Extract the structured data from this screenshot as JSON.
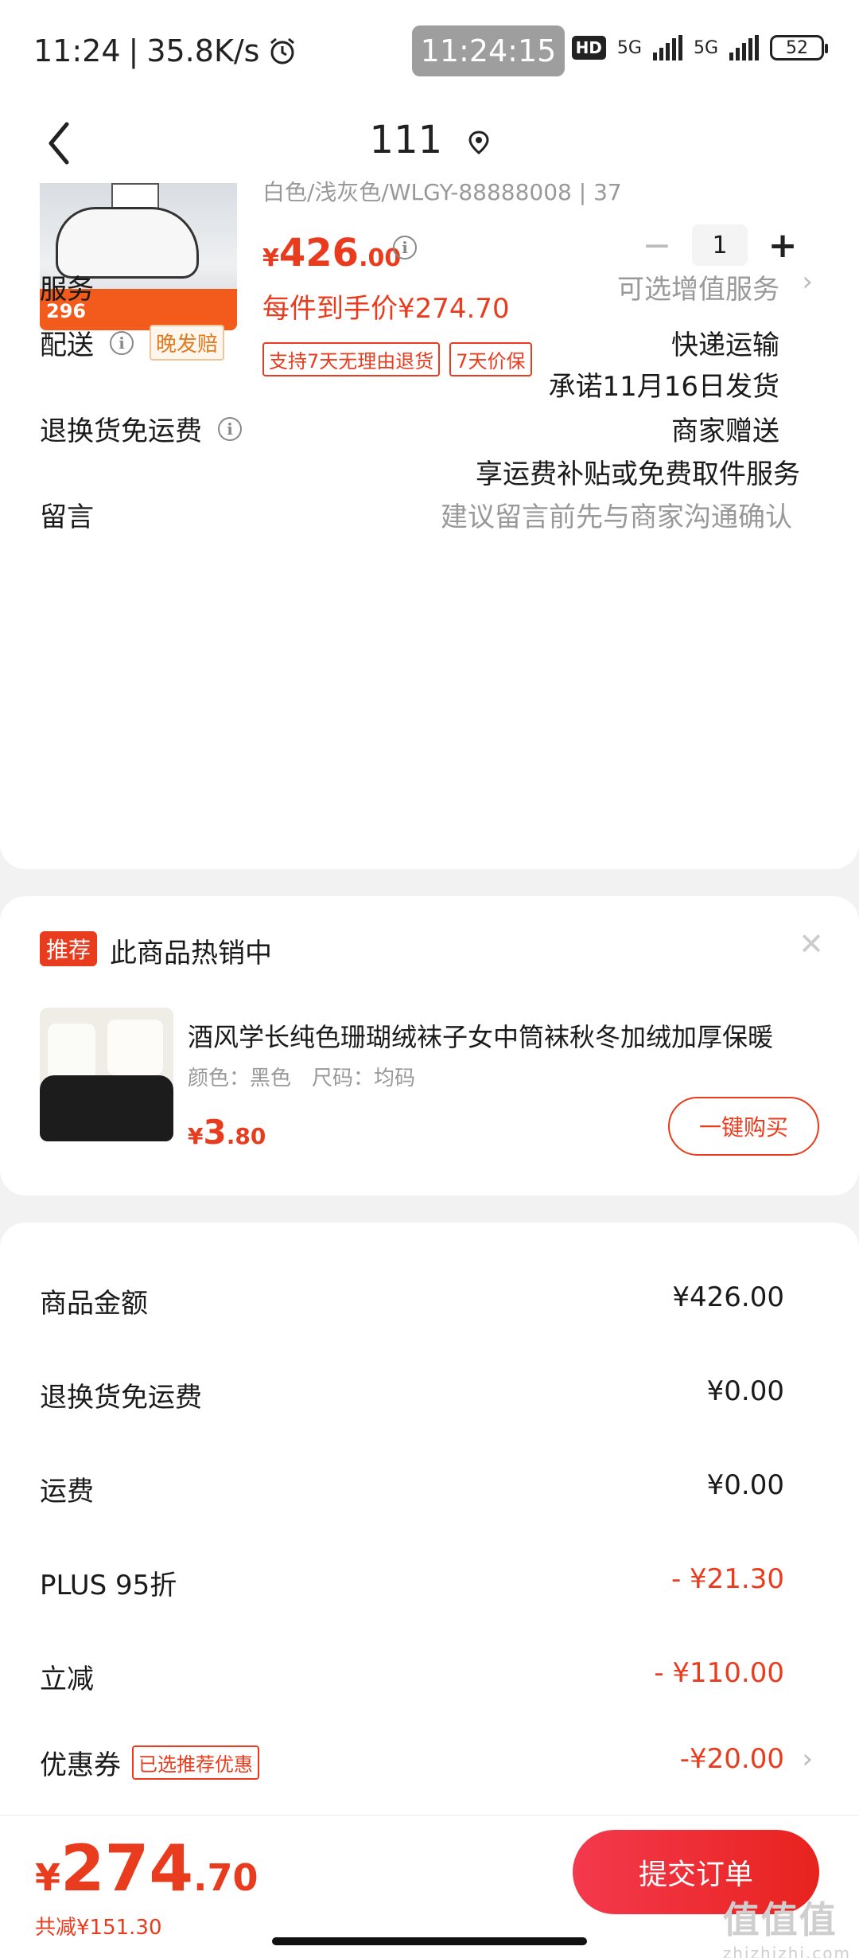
{
  "status_bar": {
    "time": "11:24",
    "net_speed": "35.8K/s",
    "center_time": "11:24:15",
    "network_hd": "HD",
    "signal_1": "5G",
    "signal_2": "5G",
    "battery": "52"
  },
  "header": {
    "title": "111"
  },
  "product": {
    "sku_text": "白色/浅灰色/WLGY-88888008 | 37",
    "image_band_text": "296",
    "price_symbol": "¥",
    "price_int": "426",
    "price_dec": ".00",
    "unit_price": "每件到手价¥274.70",
    "quantity": "1",
    "tags": [
      "支持7天无理由退货",
      "7天价保"
    ]
  },
  "rows": {
    "service_label": "服务",
    "service_value": "可选增值服务",
    "delivery_label": "配送",
    "delivery_badge": "晚发赔",
    "delivery_method": "快递运输",
    "delivery_promise": "承诺11月16日发货",
    "return_label": "退换货免运费",
    "return_value": "商家赠送",
    "return_desc": "享运费补贴或免费取件服务",
    "note_label": "留言",
    "note_placeholder": "建议留言前先与商家沟通确认"
  },
  "recommend": {
    "badge": "推荐",
    "title": "此商品热销中",
    "name": "酒风学长纯色珊瑚绒袜子女中筒袜秋冬加绒加厚保暖",
    "spec": "颜色：黑色　尺码：均码",
    "price_symbol": "¥",
    "price_int": "3",
    "price_dec": ".80",
    "buy_label": "一键购买"
  },
  "summary": {
    "items": [
      {
        "label": "商品金额",
        "value": "¥426.00"
      },
      {
        "label": "退换货免运费",
        "value": "¥0.00"
      },
      {
        "label": "运费",
        "value": "¥0.00"
      },
      {
        "label": "PLUS 95折",
        "value": "- ¥21.30"
      },
      {
        "label": "立减",
        "value": "- ¥110.00"
      },
      {
        "label": "优惠券",
        "value": "-¥20.00",
        "tag": "已选推荐优惠"
      }
    ]
  },
  "bottom": {
    "currency": "¥",
    "total_int": "274",
    "total_dec": ".70",
    "saved": "共减¥151.30",
    "submit_label": "提交订单"
  },
  "watermark": {
    "logo": "值值值",
    "site": "zhizhizhi.com"
  },
  "colors": {
    "accent": "#e93b1d",
    "submit_gradient_start": "#f4394e",
    "submit_gradient_end": "#e8231e",
    "muted": "#999999",
    "badge_orange": "#e07a1f"
  }
}
